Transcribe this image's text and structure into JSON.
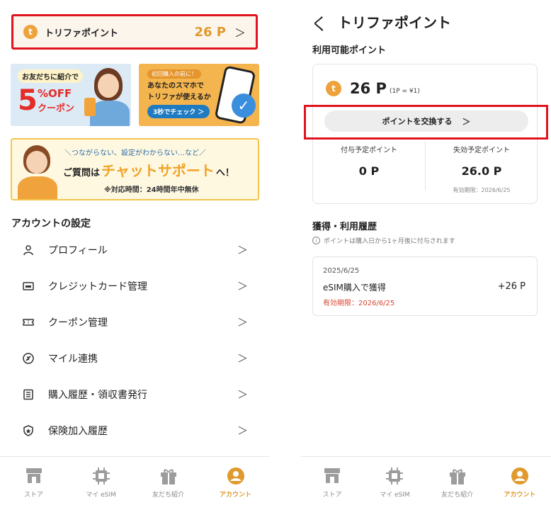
{
  "colors": {
    "accent": "#e09a2e",
    "highlight_box": "#e0141e",
    "coin": "#eda23b",
    "expiry_red": "#d9452f"
  },
  "left": {
    "points_bar": {
      "icon": "t-coin-icon",
      "coin_letter": "t",
      "label": "トリファポイント",
      "value": "26 P"
    },
    "banner_friend": {
      "top": "お友だちに紹介で",
      "big": "5",
      "off": "%OFF",
      "coupon": "クーポン"
    },
    "banner_first": {
      "small": "初回購入の前に！",
      "line1": "あなたのスマホで",
      "line2": "トリファが使えるか",
      "button": "3秒でチェック ＞"
    },
    "banner_chat": {
      "top": "＼つながらない、設定がわからない…など／",
      "pre": "ご質問は",
      "highlight": "チャットサポート",
      "post": "へ！",
      "note": "※対応時間：24時間年中無休"
    },
    "account_title": "アカウントの設定",
    "menu": [
      {
        "icon": "person-icon",
        "label": "プロフィール"
      },
      {
        "icon": "credit-card-icon",
        "label": "クレジットカード管理"
      },
      {
        "icon": "ticket-icon",
        "label": "クーポン管理"
      },
      {
        "icon": "airplane-icon",
        "label": "マイル連携"
      },
      {
        "icon": "receipt-icon",
        "label": "購入履歴・領収書発行"
      },
      {
        "icon": "shield-icon",
        "label": "保険加入履歴"
      }
    ]
  },
  "tabs": [
    {
      "icon": "store-icon",
      "label": "ストア"
    },
    {
      "icon": "chip-icon",
      "label": "マイ eSIM"
    },
    {
      "icon": "gift-icon",
      "label": "友だち紹介"
    },
    {
      "icon": "account-icon",
      "label": "アカウント",
      "active": true
    }
  ],
  "right": {
    "back": "く",
    "title": "トリファポイント",
    "available_label": "利用可能ポイント",
    "coin_letter": "t",
    "points": "26 P",
    "rate": "(1P = ¥1)",
    "exchange_button": "ポイントを交換する",
    "pending": {
      "label": "付与予定ポイント",
      "value": "0 P"
    },
    "expiring": {
      "label": "失効予定ポイント",
      "value": "26.0 P",
      "note": "有効期限：2026/6/25"
    },
    "history_title": "獲得・利用履歴",
    "history_note": "ポイントは購入日から1ヶ月後に付与されます",
    "history": [
      {
        "date": "2025/6/25",
        "desc": "eSIM購入で獲得",
        "expiry": "有効期限：2026/6/25",
        "amount": "+26 P"
      }
    ]
  }
}
